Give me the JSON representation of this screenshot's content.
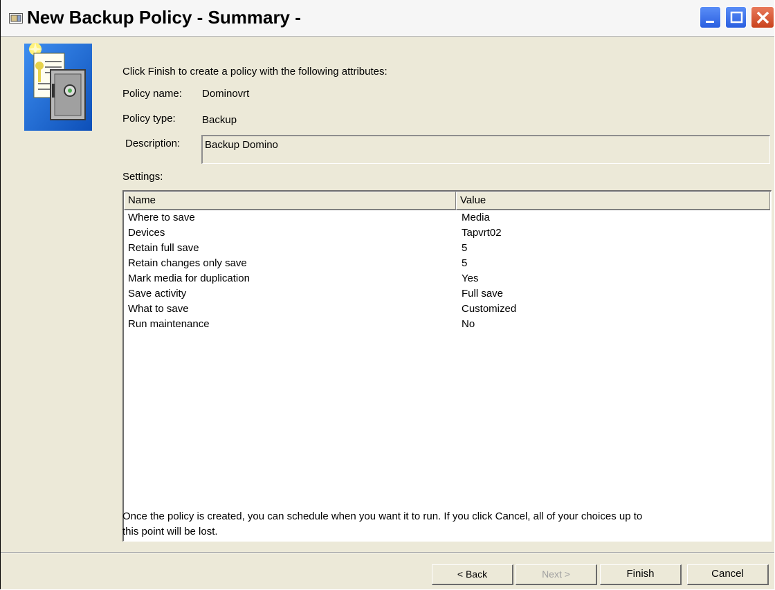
{
  "window": {
    "title": "New Backup Policy - Summary -",
    "controls": [
      "minimize-icon",
      "maximize-icon",
      "close-icon"
    ]
  },
  "summary": {
    "intro": "Click Finish to create a policy with the following attributes:",
    "policy_name_label": "Policy name:",
    "policy_name_value": "Dominovrt",
    "policy_type_label": "Policy type:",
    "policy_type_value": "Backup",
    "description_label": "Description:",
    "description_value": "Backup Domino",
    "settings_label": "Settings:"
  },
  "settings_table": {
    "columns": [
      "Name",
      "Value"
    ],
    "rows": [
      {
        "name": "Where to save",
        "value": "Media"
      },
      {
        "name": "Devices",
        "value": "Tapvrt02"
      },
      {
        "name": "Retain full save",
        "value": "5"
      },
      {
        "name": "Retain changes only save",
        "value": "5"
      },
      {
        "name": "Mark media for duplication",
        "value": "Yes"
      },
      {
        "name": "Save activity",
        "value": "Full save"
      },
      {
        "name": "What to save",
        "value": "Customized"
      },
      {
        "name": "Run maintenance",
        "value": "No"
      }
    ]
  },
  "note": {
    "line1": "Once the policy is created, you can schedule when you want it to run. If you click Cancel, all of your choices up to",
    "line2": "this point will be lost."
  },
  "buttons": {
    "back": "< Back",
    "next": "Next >",
    "finish": "Finish",
    "cancel": "Cancel"
  },
  "colors": {
    "dialog_bg": "#ece9d8",
    "titlebar_bg": "#f6f6f6",
    "close_button": "#c9421c",
    "window_buttons": "#2a5fe0",
    "disabled_text": "#a0a0a0"
  }
}
